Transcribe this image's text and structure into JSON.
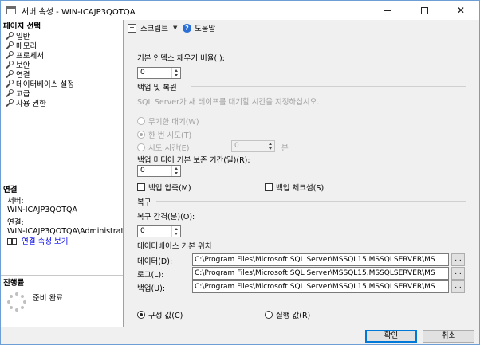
{
  "window": {
    "title": "서버 속성 - WIN-ICAJP3QOTQA"
  },
  "sidebar": {
    "page_select_title": "페이지 선택",
    "items": [
      {
        "label": "일반"
      },
      {
        "label": "메모리"
      },
      {
        "label": "프로세서"
      },
      {
        "label": "보안"
      },
      {
        "label": "연결"
      },
      {
        "label": "데이터베이스 설정"
      },
      {
        "label": "고급"
      },
      {
        "label": "사용 권한"
      }
    ],
    "connection_title": "연결",
    "server_label": "서버:",
    "server_value": "WIN-ICAJP3QOTQA",
    "conn_label": "연결:",
    "conn_value": "WIN-ICAJP3QOTQA\\Administrato",
    "conn_link": "연결 속성 보기",
    "progress_title": "진행률",
    "progress_status": "준비 완료"
  },
  "toolbar": {
    "script_label": "스크립트",
    "help_label": "도움말"
  },
  "main": {
    "fill_factor_label": "기본 인덱스 채우기 비율(I):",
    "fill_factor_value": "0",
    "backup_restore_title": "백업 및 복원",
    "tape_hint": "SQL Server가 새 테이프를 대기할 시간을 지정하십시오.",
    "radio_infinite": "무기한 대기(W)",
    "radio_once": "한 번 시도(T)",
    "radio_try_time": "시도 시간(E)",
    "try_time_value": "0",
    "try_time_unit": "분",
    "retention_label": "백업 미디어 기본 보존 기간(일)(R):",
    "retention_value": "0",
    "compress_label": "백업 압축(M)",
    "checksum_label": "백업 체크섬(S)",
    "recovery_title": "복구",
    "recovery_interval_label": "복구 간격(분)(O):",
    "recovery_interval_value": "0",
    "db_locations_title": "데이터베이스 기본 위치",
    "data_label": "데이터(D):",
    "data_path": "C:\\Program Files\\Microsoft SQL Server\\MSSQL15.MSSQLSERVER\\MS",
    "log_label": "로그(L):",
    "log_path": "C:\\Program Files\\Microsoft SQL Server\\MSSQL15.MSSQLSERVER\\MS",
    "backup_label": "백업(U):",
    "backup_path": "C:\\Program Files\\Microsoft SQL Server\\MSSQL15.MSSQLSERVER\\MS",
    "browse_label": "...",
    "radio_configured": "구성 값(C)",
    "radio_running": "실행 값(R)"
  },
  "footer": {
    "ok_label": "확인",
    "cancel_label": "취소"
  }
}
